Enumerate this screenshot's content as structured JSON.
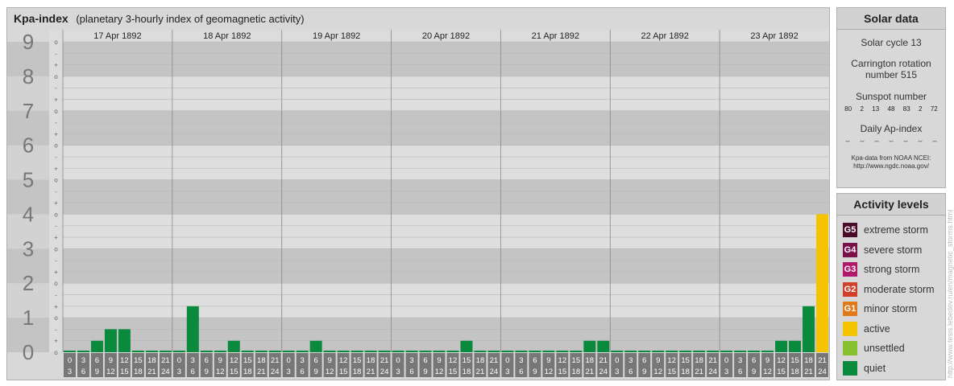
{
  "header": {
    "title": "Kpa-index",
    "subtitle": "(planetary 3-hourly index of geomagnetic activity)"
  },
  "solar": {
    "header": "Solar data",
    "solar_cycle": "Solar cycle 13",
    "carrington_line1": "Carrington rotation",
    "carrington_line2": "number 515",
    "sunspot_label": "Sunspot number",
    "sunspot_values": [
      "80",
      "2",
      "13",
      "48",
      "83",
      "2",
      "72"
    ],
    "ap_label": "Daily Ap-index",
    "ap_values": [
      "--",
      "--",
      "--",
      "--",
      "--",
      "--",
      "--"
    ],
    "note_line1": "Kpa-data from NOAA NCEI:",
    "note_line2": "http://www.ngdc.noaa.gov/"
  },
  "activity": {
    "header": "Activity levels",
    "levels": [
      {
        "code": "G5",
        "label": "extreme storm",
        "color": "#4a0a2a"
      },
      {
        "code": "G4",
        "label": "severe storm",
        "color": "#7a1048"
      },
      {
        "code": "G3",
        "label": "strong storm",
        "color": "#b0186a"
      },
      {
        "code": "G2",
        "label": "moderate storm",
        "color": "#d2402a"
      },
      {
        "code": "G1",
        "label": "minor storm",
        "color": "#e07a18"
      },
      {
        "code": "",
        "label": "active",
        "color": "#f5c400"
      },
      {
        "code": "",
        "label": "unsettled",
        "color": "#88c030"
      },
      {
        "code": "",
        "label": "quiet",
        "color": "#0a8a3c"
      }
    ]
  },
  "watermark": "http://www.tesis.lebedev.ru/en/magnetic_storms.html",
  "chart_data": {
    "type": "bar",
    "ylim": [
      0,
      9
    ],
    "y_ticks": [
      "0",
      "1",
      "2",
      "3",
      "4",
      "5",
      "6",
      "7",
      "8",
      "9"
    ],
    "y_minor_labels": [
      "o",
      "+",
      "-"
    ],
    "days": [
      "17 Apr 1892",
      "18 Apr 1892",
      "19 Apr 1892",
      "20 Apr 1892",
      "21 Apr 1892",
      "22 Apr 1892",
      "23 Apr 1892"
    ],
    "hour_labels_top": [
      "0",
      "3",
      "6",
      "9",
      "12",
      "15",
      "18",
      "21"
    ],
    "hour_labels_bottom": [
      "3",
      "6",
      "9",
      "12",
      "15",
      "18",
      "21",
      "24"
    ],
    "values": [
      [
        0,
        0,
        0.333,
        0.667,
        0.667,
        0,
        0,
        0
      ],
      [
        0,
        1.333,
        0,
        0,
        0.333,
        0,
        0,
        0
      ],
      [
        0,
        0,
        0.333,
        0,
        0,
        0,
        0,
        0
      ],
      [
        0,
        0,
        0,
        0,
        0,
        0.333,
        0,
        0
      ],
      [
        0,
        0,
        0,
        0,
        0,
        0,
        0.333,
        0.333
      ],
      [
        0,
        0,
        0,
        0,
        0,
        0,
        0,
        0
      ],
      [
        0,
        0,
        0,
        0,
        0.333,
        0.333,
        1.333,
        4.0
      ]
    ],
    "colors": {
      "quiet": "#0a8a3c",
      "active": "#f5c400"
    }
  }
}
